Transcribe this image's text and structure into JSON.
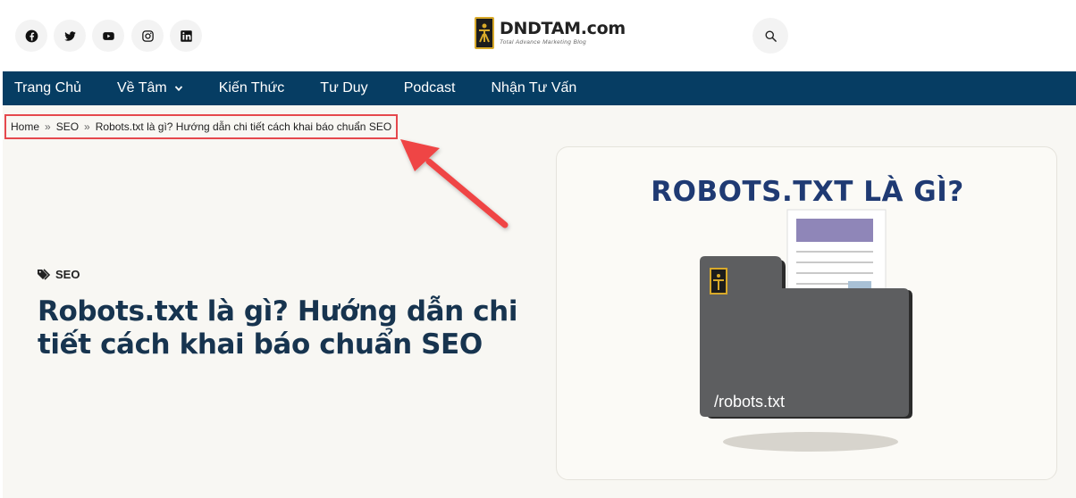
{
  "header": {
    "social": [
      {
        "name": "facebook-icon"
      },
      {
        "name": "twitter-icon"
      },
      {
        "name": "youtube-icon"
      },
      {
        "name": "instagram-icon"
      },
      {
        "name": "linkedin-icon"
      }
    ],
    "logo_name": "DNDTAM.com",
    "logo_tagline": "Total Advance Marketing Blog"
  },
  "nav": {
    "items": [
      {
        "label": "Trang Chủ"
      },
      {
        "label": "Về Tâm"
      },
      {
        "label": "Kiến Thức"
      },
      {
        "label": "Tư Duy"
      },
      {
        "label": "Podcast"
      },
      {
        "label": "Nhận Tư Vấn"
      }
    ]
  },
  "breadcrumb": {
    "home": "Home",
    "sep": "»",
    "category": "SEO",
    "current": "Robots.txt là gì? Hướng dẫn chi tiết cách khai báo chuẩn SEO"
  },
  "post": {
    "category": "SEO",
    "title": "Robots.txt là gì? Hướng dẫn chi tiết cách khai báo chuẩn SEO"
  },
  "featured_image": {
    "heading": "ROBOTS.TXT LÀ GÌ?",
    "folder_label": "/robots.txt"
  },
  "colors": {
    "nav_bg": "#063d63",
    "title": "#17344f",
    "highlight": "#e5484d",
    "card_heading": "#1f3a73"
  }
}
